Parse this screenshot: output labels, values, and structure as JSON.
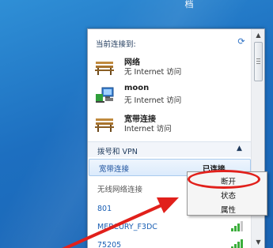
{
  "desktop": {
    "glyph": "档"
  },
  "flyout": {
    "current_header": "当前连接到:",
    "connections": [
      {
        "name": "网络",
        "status": "无 Internet 访问",
        "icon": "bench-network-icon"
      },
      {
        "name": "moon",
        "status": "无 Internet 访问",
        "icon": "computer-network-icon"
      },
      {
        "name": "宽带连接",
        "status": "Internet 访问",
        "icon": "bench-network-icon"
      }
    ],
    "dial_section": "拨号和 VPN",
    "dial_item": {
      "name": "宽带连接",
      "state": "已连接"
    },
    "wifi_header": "无线网络连接",
    "wifi_networks": [
      "801",
      "MERCURY_F3DC",
      "75205"
    ]
  },
  "context_menu": {
    "items": [
      "断开",
      "状态",
      "属性"
    ]
  },
  "colors": {
    "accent": "#1a5fb4",
    "annotation": "#e1201b"
  }
}
